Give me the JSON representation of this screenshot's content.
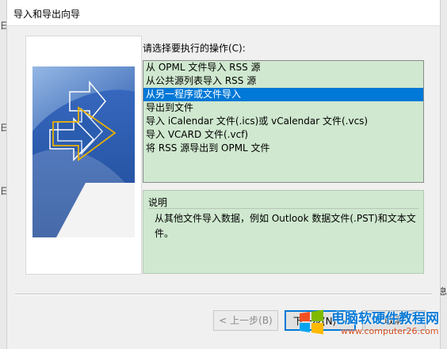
{
  "dialog": {
    "title": "导入和导出向导"
  },
  "prompt": "请选择要执行的操作(C):",
  "actions": [
    {
      "label": "从 OPML 文件导入 RSS 源"
    },
    {
      "label": "从公共源列表导入 RSS 源"
    },
    {
      "label": "从另一程序或文件导入"
    },
    {
      "label": "导出到文件"
    },
    {
      "label": "导入 iCalendar 文件(.ics)或 vCalendar 文件(.vcs)"
    },
    {
      "label": "导入 VCARD 文件(.vcf)"
    },
    {
      "label": "将 RSS 源导出到 OPML 文件"
    }
  ],
  "selected_index": 2,
  "description": {
    "title": "说明",
    "text": "从其他文件导入数据，例如 Outlook 数据文件(.PST)和文本文件。"
  },
  "buttons": {
    "back": "< 上一步(B)",
    "next": "下一步(N) >",
    "cancel": "取消"
  },
  "background": {
    "left_marks": [
      "日",
      "日",
      "日"
    ],
    "right_mark": "息"
  },
  "watermark": {
    "title": "电脑软硬件教程网",
    "url": "www.computer26.com"
  },
  "colors": {
    "list_bg": "#cfe8cf",
    "selection": "#0078d7",
    "accent": "#0078d7"
  }
}
